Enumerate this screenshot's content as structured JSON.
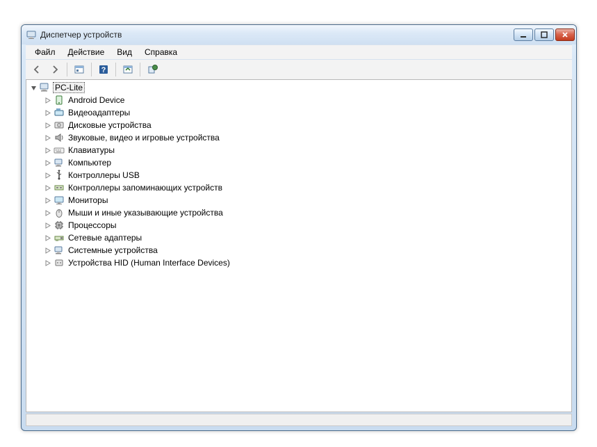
{
  "window": {
    "title": "Диспетчер устройств"
  },
  "menu": {
    "file": "Файл",
    "action": "Действие",
    "view": "Вид",
    "help": "Справка"
  },
  "tree": {
    "root": "PC-Lite",
    "items": [
      "Android Device",
      "Видеоадаптеры",
      "Дисковые устройства",
      "Звуковые, видео и игровые устройства",
      "Клавиатуры",
      "Компьютер",
      "Контроллеры USB",
      "Контроллеры запоминающих устройств",
      "Мониторы",
      "Мыши и иные указывающие устройства",
      "Процессоры",
      "Сетевые адаптеры",
      "Системные устройства",
      "Устройства HID (Human Interface Devices)"
    ]
  }
}
